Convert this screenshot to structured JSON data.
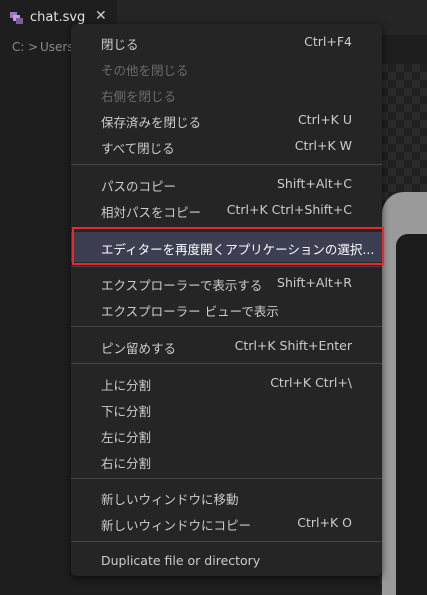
{
  "tab": {
    "label": "chat.svg",
    "close": "✕"
  },
  "breadcrumb": {
    "drive": "C:",
    "separator": ">",
    "folder": "Users"
  },
  "colors": {
    "highlight_border": "#e8282d",
    "selected_bg": "#3b3f51",
    "menu_bg": "#252526"
  },
  "menu": {
    "close": {
      "label": "閉じる",
      "shortcut": "Ctrl+F4"
    },
    "close_others": {
      "label": "その他を閉じる"
    },
    "close_right": {
      "label": "右側を閉じる"
    },
    "close_saved": {
      "label": "保存済みを閉じる",
      "shortcut": "Ctrl+K U"
    },
    "close_all": {
      "label": "すべて閉じる",
      "shortcut": "Ctrl+K W"
    },
    "copy_path": {
      "label": "パスのコピー",
      "shortcut": "Shift+Alt+C"
    },
    "copy_relative_path": {
      "label": "相対パスをコピー",
      "shortcut": "Ctrl+K Ctrl+Shift+C"
    },
    "reopen_with": {
      "label": "エディターを再度開くアプリケーションの選択..."
    },
    "reveal_explorer": {
      "label": "エクスプローラーで表示する",
      "shortcut": "Shift+Alt+R"
    },
    "reveal_explorer_view": {
      "label": "エクスプローラー ビューで表示"
    },
    "pin": {
      "label": "ピン留めする",
      "shortcut": "Ctrl+K Shift+Enter"
    },
    "split_up": {
      "label": "上に分割",
      "shortcut": "Ctrl+K Ctrl+\\"
    },
    "split_down": {
      "label": "下に分割"
    },
    "split_left": {
      "label": "左に分割"
    },
    "split_right": {
      "label": "右に分割"
    },
    "move_new_window": {
      "label": "新しいウィンドウに移動"
    },
    "copy_new_window": {
      "label": "新しいウィンドウにコピー",
      "shortcut": "Ctrl+K O"
    },
    "duplicate": {
      "label": "Duplicate file or directory"
    }
  }
}
